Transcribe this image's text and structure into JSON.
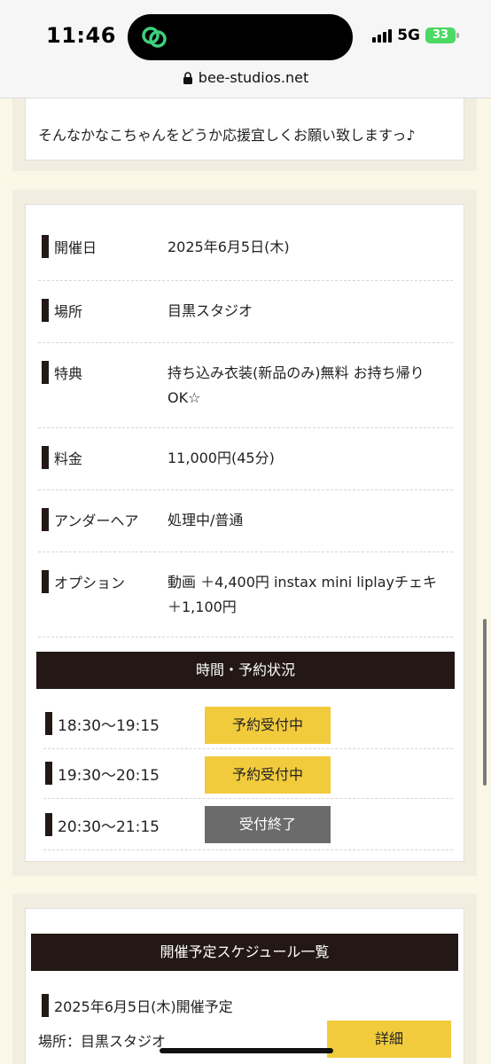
{
  "status_bar": {
    "time": "11:46",
    "network": "5G",
    "battery": "33"
  },
  "url_bar": {
    "domain": "bee-studios.net"
  },
  "intro": {
    "text": "そんなかなこちゃんをどうか応援宜しくお願い致しますっ♪"
  },
  "details": {
    "rows": [
      {
        "label": "開催日",
        "value": "2025年6月5日(木)"
      },
      {
        "label": "場所",
        "value": "目黒スタジオ"
      },
      {
        "label": "特典",
        "value": "持ち込み衣装(新品のみ)無料 お持ち帰りOK☆"
      },
      {
        "label": "料金",
        "value": "11,000円(45分)"
      },
      {
        "label": "アンダーヘア",
        "value": "処理中/普通"
      },
      {
        "label": "オプション",
        "value": "動画 ＋4,400円 instax mini liplayチェキ ＋1,100円"
      }
    ]
  },
  "reservation": {
    "header": "時間・予約状況",
    "slots": [
      {
        "time": "18:30〜19:15",
        "status": "予約受付中"
      },
      {
        "time": "19:30〜20:15",
        "status": "予約受付中"
      },
      {
        "time": "20:30〜21:15",
        "status": "受付終了"
      }
    ]
  },
  "schedule": {
    "header": "開催予定スケジュール一覧",
    "entry_date": "2025年6月5日(木)開催予定",
    "entry_place": "場所：目黒スタジオ",
    "detail_button": "詳細"
  },
  "colors": {
    "accent_yellow": "#f2cb3d",
    "dark": "#231815",
    "closed_gray": "#6b6b6b",
    "page_bg": "#fbf7e6"
  }
}
